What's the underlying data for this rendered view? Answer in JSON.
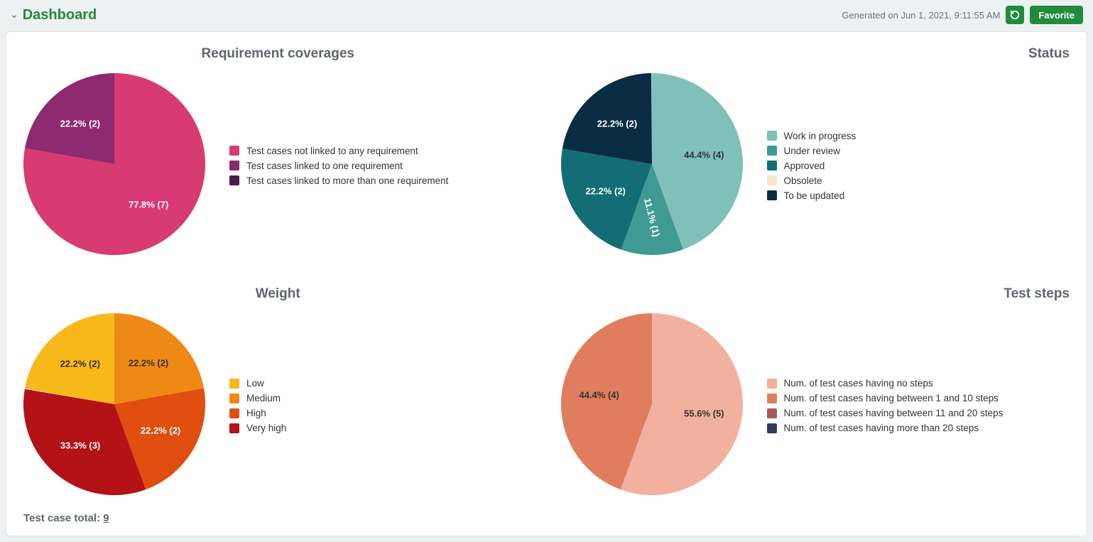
{
  "header": {
    "title": "Dashboard",
    "generated_label": "Generated on Jun 1, 2021, 9:11:55 AM",
    "favorite_label": "Favorite"
  },
  "footer": {
    "label": "Test case total: ",
    "value": "9"
  },
  "chart_data": [
    {
      "type": "pie",
      "title": "Requirement coverages",
      "series": [
        {
          "name": "Test cases not linked to any requirement",
          "value": 7,
          "percent": 77.8,
          "color": "#d83a72",
          "label_color": "#ffffff"
        },
        {
          "name": "Test cases linked to one requirement",
          "value": 2,
          "percent": 22.2,
          "color": "#8e2a70",
          "label_color": "#ffffff"
        },
        {
          "name": "Test cases linked to more than one requirement",
          "value": 0,
          "percent": 0,
          "color": "#4a1c50",
          "label_color": "#ffffff"
        }
      ]
    },
    {
      "type": "pie",
      "title": "Status",
      "series": [
        {
          "name": "Work in progress",
          "value": 4,
          "percent": 44.4,
          "color": "#7fc1b9",
          "label_color": "#333333"
        },
        {
          "name": "Under review",
          "value": 1,
          "percent": 11.1,
          "color": "#3f9a94",
          "label_color": "#ffffff",
          "rotate": true
        },
        {
          "name": "Approved",
          "value": 2,
          "percent": 22.2,
          "color": "#126e74",
          "label_color": "#ffffff"
        },
        {
          "name": "Obsolete",
          "value": 0,
          "percent": 0,
          "color": "#f2e8c3",
          "label_color": "#333333"
        },
        {
          "name": "To be updated",
          "value": 2,
          "percent": 22.2,
          "color": "#0b2d44",
          "label_color": "#ffffff"
        }
      ]
    },
    {
      "type": "pie",
      "title": "Weight",
      "series": [
        {
          "name": "Low",
          "value": 2,
          "percent": 22.2,
          "color": "#f7b81a",
          "label_color": "#333333"
        },
        {
          "name": "Medium",
          "value": 2,
          "percent": 22.2,
          "color": "#ef8915",
          "label_color": "#333333"
        },
        {
          "name": "High",
          "value": 2,
          "percent": 22.2,
          "color": "#e04e10",
          "label_color": "#ffffff"
        },
        {
          "name": "Very high",
          "value": 3,
          "percent": 33.3,
          "color": "#b31217",
          "label_color": "#ffffff"
        }
      ],
      "start_angle": -80
    },
    {
      "type": "pie",
      "title": "Test steps",
      "series": [
        {
          "name": "Num. of test cases having no steps",
          "value": 5,
          "percent": 55.6,
          "color": "#f2b19e",
          "label_color": "#333333"
        },
        {
          "name": "Num. of test cases having between 1 and 10 steps",
          "value": 4,
          "percent": 44.4,
          "color": "#e07d5e",
          "label_color": "#333333"
        },
        {
          "name": "Num. of test cases having between 11 and 20 steps",
          "value": 0,
          "percent": 0,
          "color": "#a95b5b",
          "label_color": "#ffffff"
        },
        {
          "name": "Num. of test cases having more than 20 steps",
          "value": 0,
          "percent": 0,
          "color": "#2d3b5f",
          "label_color": "#ffffff"
        }
      ]
    }
  ]
}
